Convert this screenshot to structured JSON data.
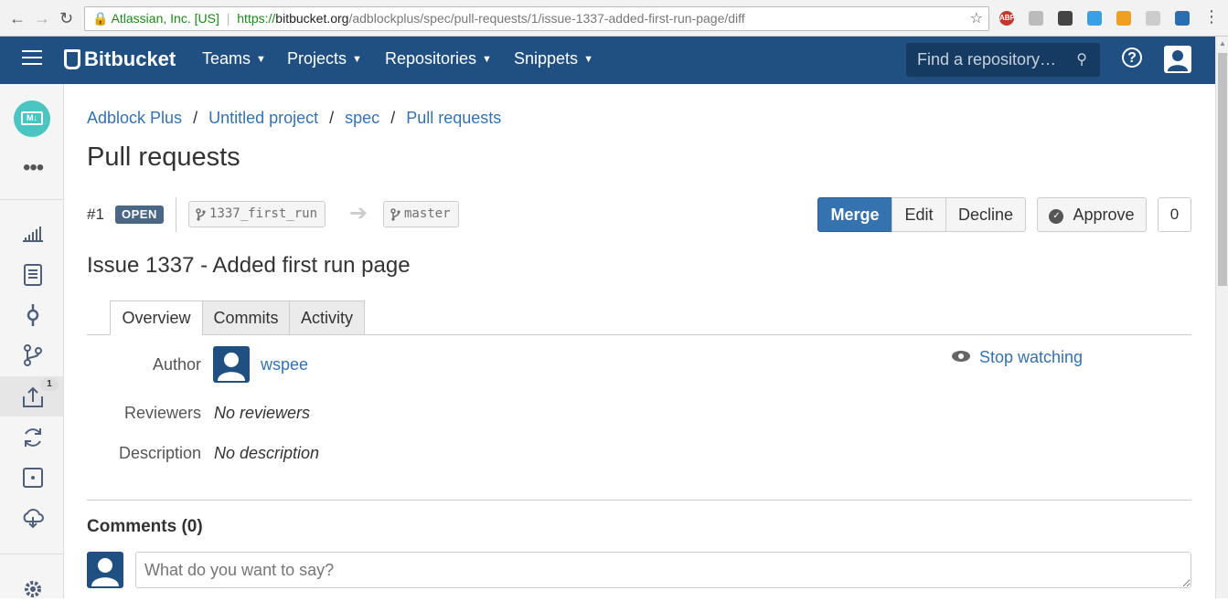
{
  "browser": {
    "back_icon": "arrow-left",
    "forward_icon": "arrow-right",
    "reload_icon": "reload",
    "security_label": "Atlassian, Inc. [US]",
    "url_protocol": "https://",
    "url_host": "bitbucket.org",
    "url_path": "/adblockplus/spec/pull-requests/1/issue-1337-added-first-run-page/diff",
    "extension_abp_label": "ABP"
  },
  "topnav": {
    "logo_text": "Bitbucket",
    "items": [
      {
        "label": "Teams"
      },
      {
        "label": "Projects"
      },
      {
        "label": "Repositories"
      },
      {
        "label": "Snippets"
      }
    ],
    "search_placeholder": "Find a repository…",
    "help_label": "?"
  },
  "sidebar": {
    "repo_avatar_label": "M↓",
    "more_label": "•••",
    "pull_requests_badge": "1",
    "items": [
      "overview",
      "source",
      "commits",
      "branches",
      "pull-requests",
      "pipelines",
      "issues",
      "downloads",
      "settings"
    ]
  },
  "breadcrumbs": [
    {
      "label": "Adblock Plus"
    },
    {
      "label": "Untitled project"
    },
    {
      "label": "spec"
    },
    {
      "label": "Pull requests"
    }
  ],
  "page_title": "Pull requests",
  "pull_request": {
    "number": "#1",
    "status": "OPEN",
    "source_branch": "1337_first_run",
    "destination_branch": "master",
    "title": "Issue 1337 - Added first run page",
    "approvals_count": "0"
  },
  "actions": {
    "merge": "Merge",
    "edit": "Edit",
    "decline": "Decline",
    "approve": "Approve"
  },
  "tabs": [
    {
      "label": "Overview",
      "active": true
    },
    {
      "label": "Commits",
      "active": false
    },
    {
      "label": "Activity",
      "active": false
    }
  ],
  "details": {
    "author_label": "Author",
    "author_name": "wspee",
    "reviewers_label": "Reviewers",
    "reviewers_value": "No reviewers",
    "description_label": "Description",
    "description_value": "No description",
    "watch_label": "Stop watching"
  },
  "comments": {
    "heading": "Comments (0)",
    "placeholder": "What do you want to say?"
  },
  "colors": {
    "nav_bg": "#205081",
    "link": "#3572b0",
    "primary_button": "#3572b0",
    "status_lozenge": "#4a6785",
    "repo_avatar": "#4bc5c1"
  }
}
